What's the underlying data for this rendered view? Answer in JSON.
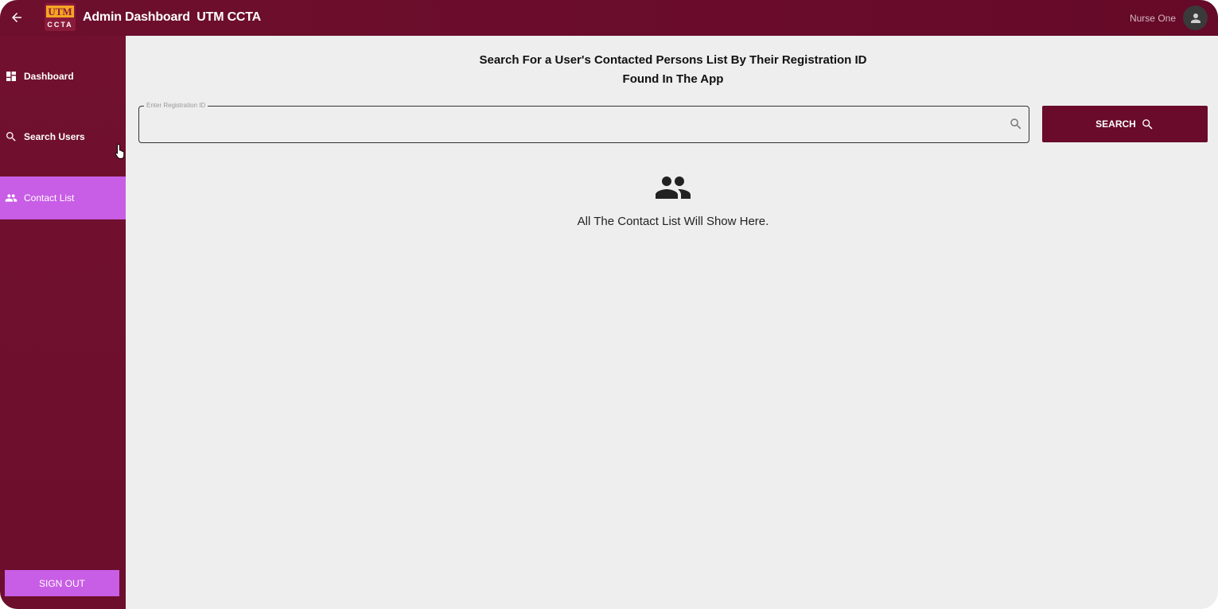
{
  "header": {
    "logo_top": "UTM",
    "logo_bottom": "CCTA",
    "title": "Admin Dashboard  UTM CCTA",
    "user_name": "Nurse One"
  },
  "sidebar": {
    "items": [
      {
        "label": "Dashboard",
        "icon": "dashboard-icon"
      },
      {
        "label": "Search Users",
        "icon": "search-icon"
      },
      {
        "label": "Contact List",
        "icon": "people-icon",
        "active": true
      }
    ],
    "sign_out": "SIGN OUT"
  },
  "main": {
    "heading_line1": "Search For a User's Contacted Persons List By Their Registration ID",
    "heading_line2": "Found In The App",
    "search": {
      "label": "Enter Registration ID",
      "value": "",
      "button": "SEARCH"
    },
    "empty_message": "All The Contact List Will Show Here."
  },
  "colors": {
    "brand": "#6a0b2b",
    "accent": "#c85de6",
    "background": "#eeeeee"
  }
}
